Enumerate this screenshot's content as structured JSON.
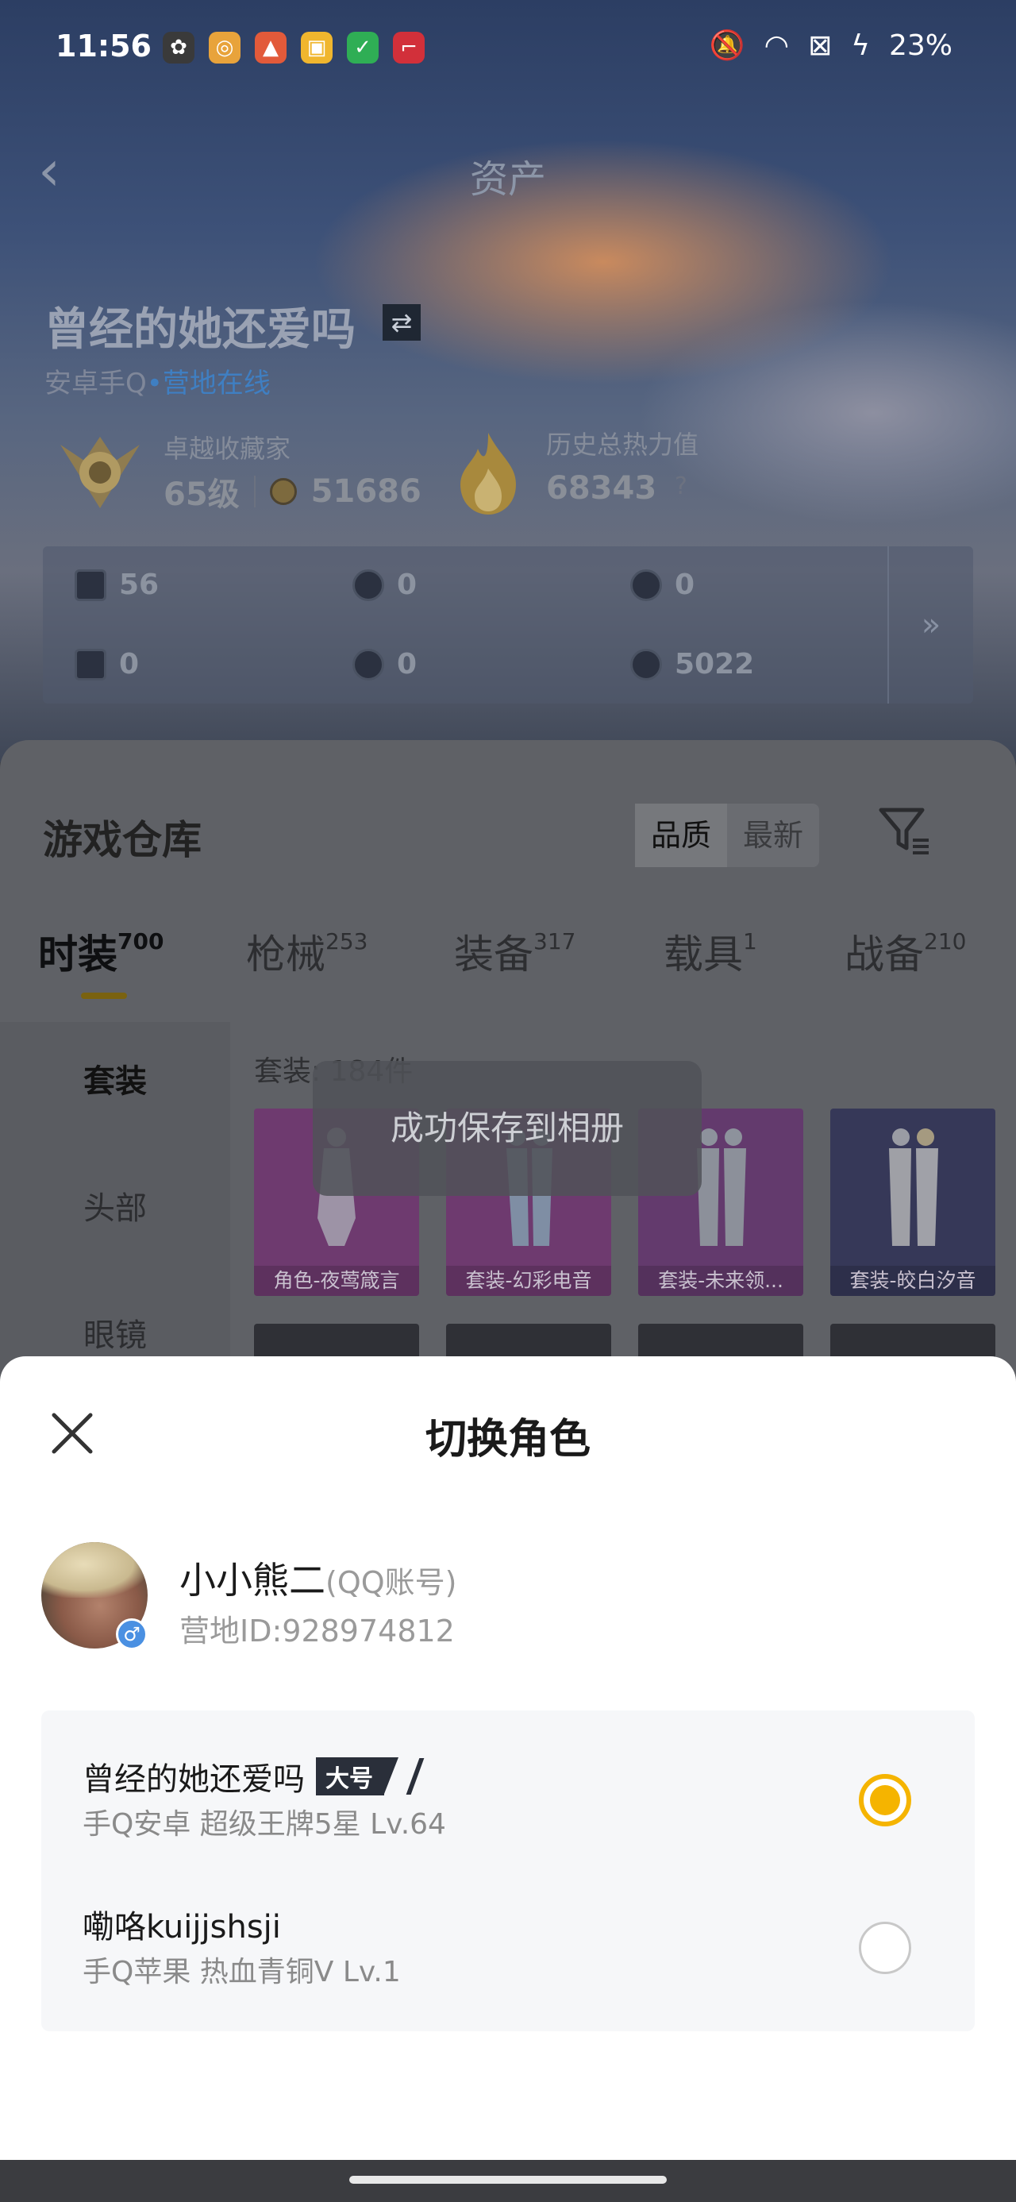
{
  "status_bar": {
    "time": "11:56",
    "battery": "23%"
  },
  "header": {
    "title": "资产"
  },
  "profile": {
    "role_name": "曾经的她还爱吗",
    "platform": "安卓手Q",
    "online_text": "营地在线",
    "rank_title": "卓越收藏家",
    "level": "65级",
    "coins": "51686",
    "heat_title": "历史总热力值",
    "heat_value": "68343",
    "heat_help": "?"
  },
  "stats": [
    {
      "value": "56"
    },
    {
      "value": "0"
    },
    {
      "value": "0"
    },
    {
      "value": "0"
    },
    {
      "value": "0"
    },
    {
      "value": "5022"
    }
  ],
  "warehouse": {
    "title": "游戏仓库",
    "sort_quality": "品质",
    "sort_newest": "最新",
    "tabs": [
      {
        "label": "时装",
        "count": "700"
      },
      {
        "label": "枪械",
        "count": "253"
      },
      {
        "label": "装备",
        "count": "317"
      },
      {
        "label": "载具",
        "count": "1"
      },
      {
        "label": "战备",
        "count": "210"
      }
    ],
    "side_items": [
      "套装",
      "头部",
      "眼镜"
    ],
    "grid_label": "套装: 184件",
    "cards": [
      {
        "caption": "角色-夜莺箴言",
        "color": "#7c3a7c"
      },
      {
        "caption": "套装-幻彩电音",
        "color": "#7c3a7c"
      },
      {
        "caption": "套装-未来领...",
        "color": "#6e3a78"
      },
      {
        "caption": "套装-皎白汐音",
        "color": "#3b3d66"
      }
    ]
  },
  "toast": "成功保存到相册",
  "sheet": {
    "title": "切换角色",
    "user_name": "小小熊二",
    "account_type": "(QQ账号)",
    "camp_id": "营地ID:928974812",
    "roles": [
      {
        "name": "曾经的她还爱吗",
        "tag": "大号",
        "desc": "手Q安卓  超级王牌5星  Lv.64",
        "selected": true
      },
      {
        "name": "嘞咯kuijjshsji",
        "tag": "",
        "desc": "手Q苹果  热血青铜V  Lv.1",
        "selected": false
      }
    ]
  }
}
